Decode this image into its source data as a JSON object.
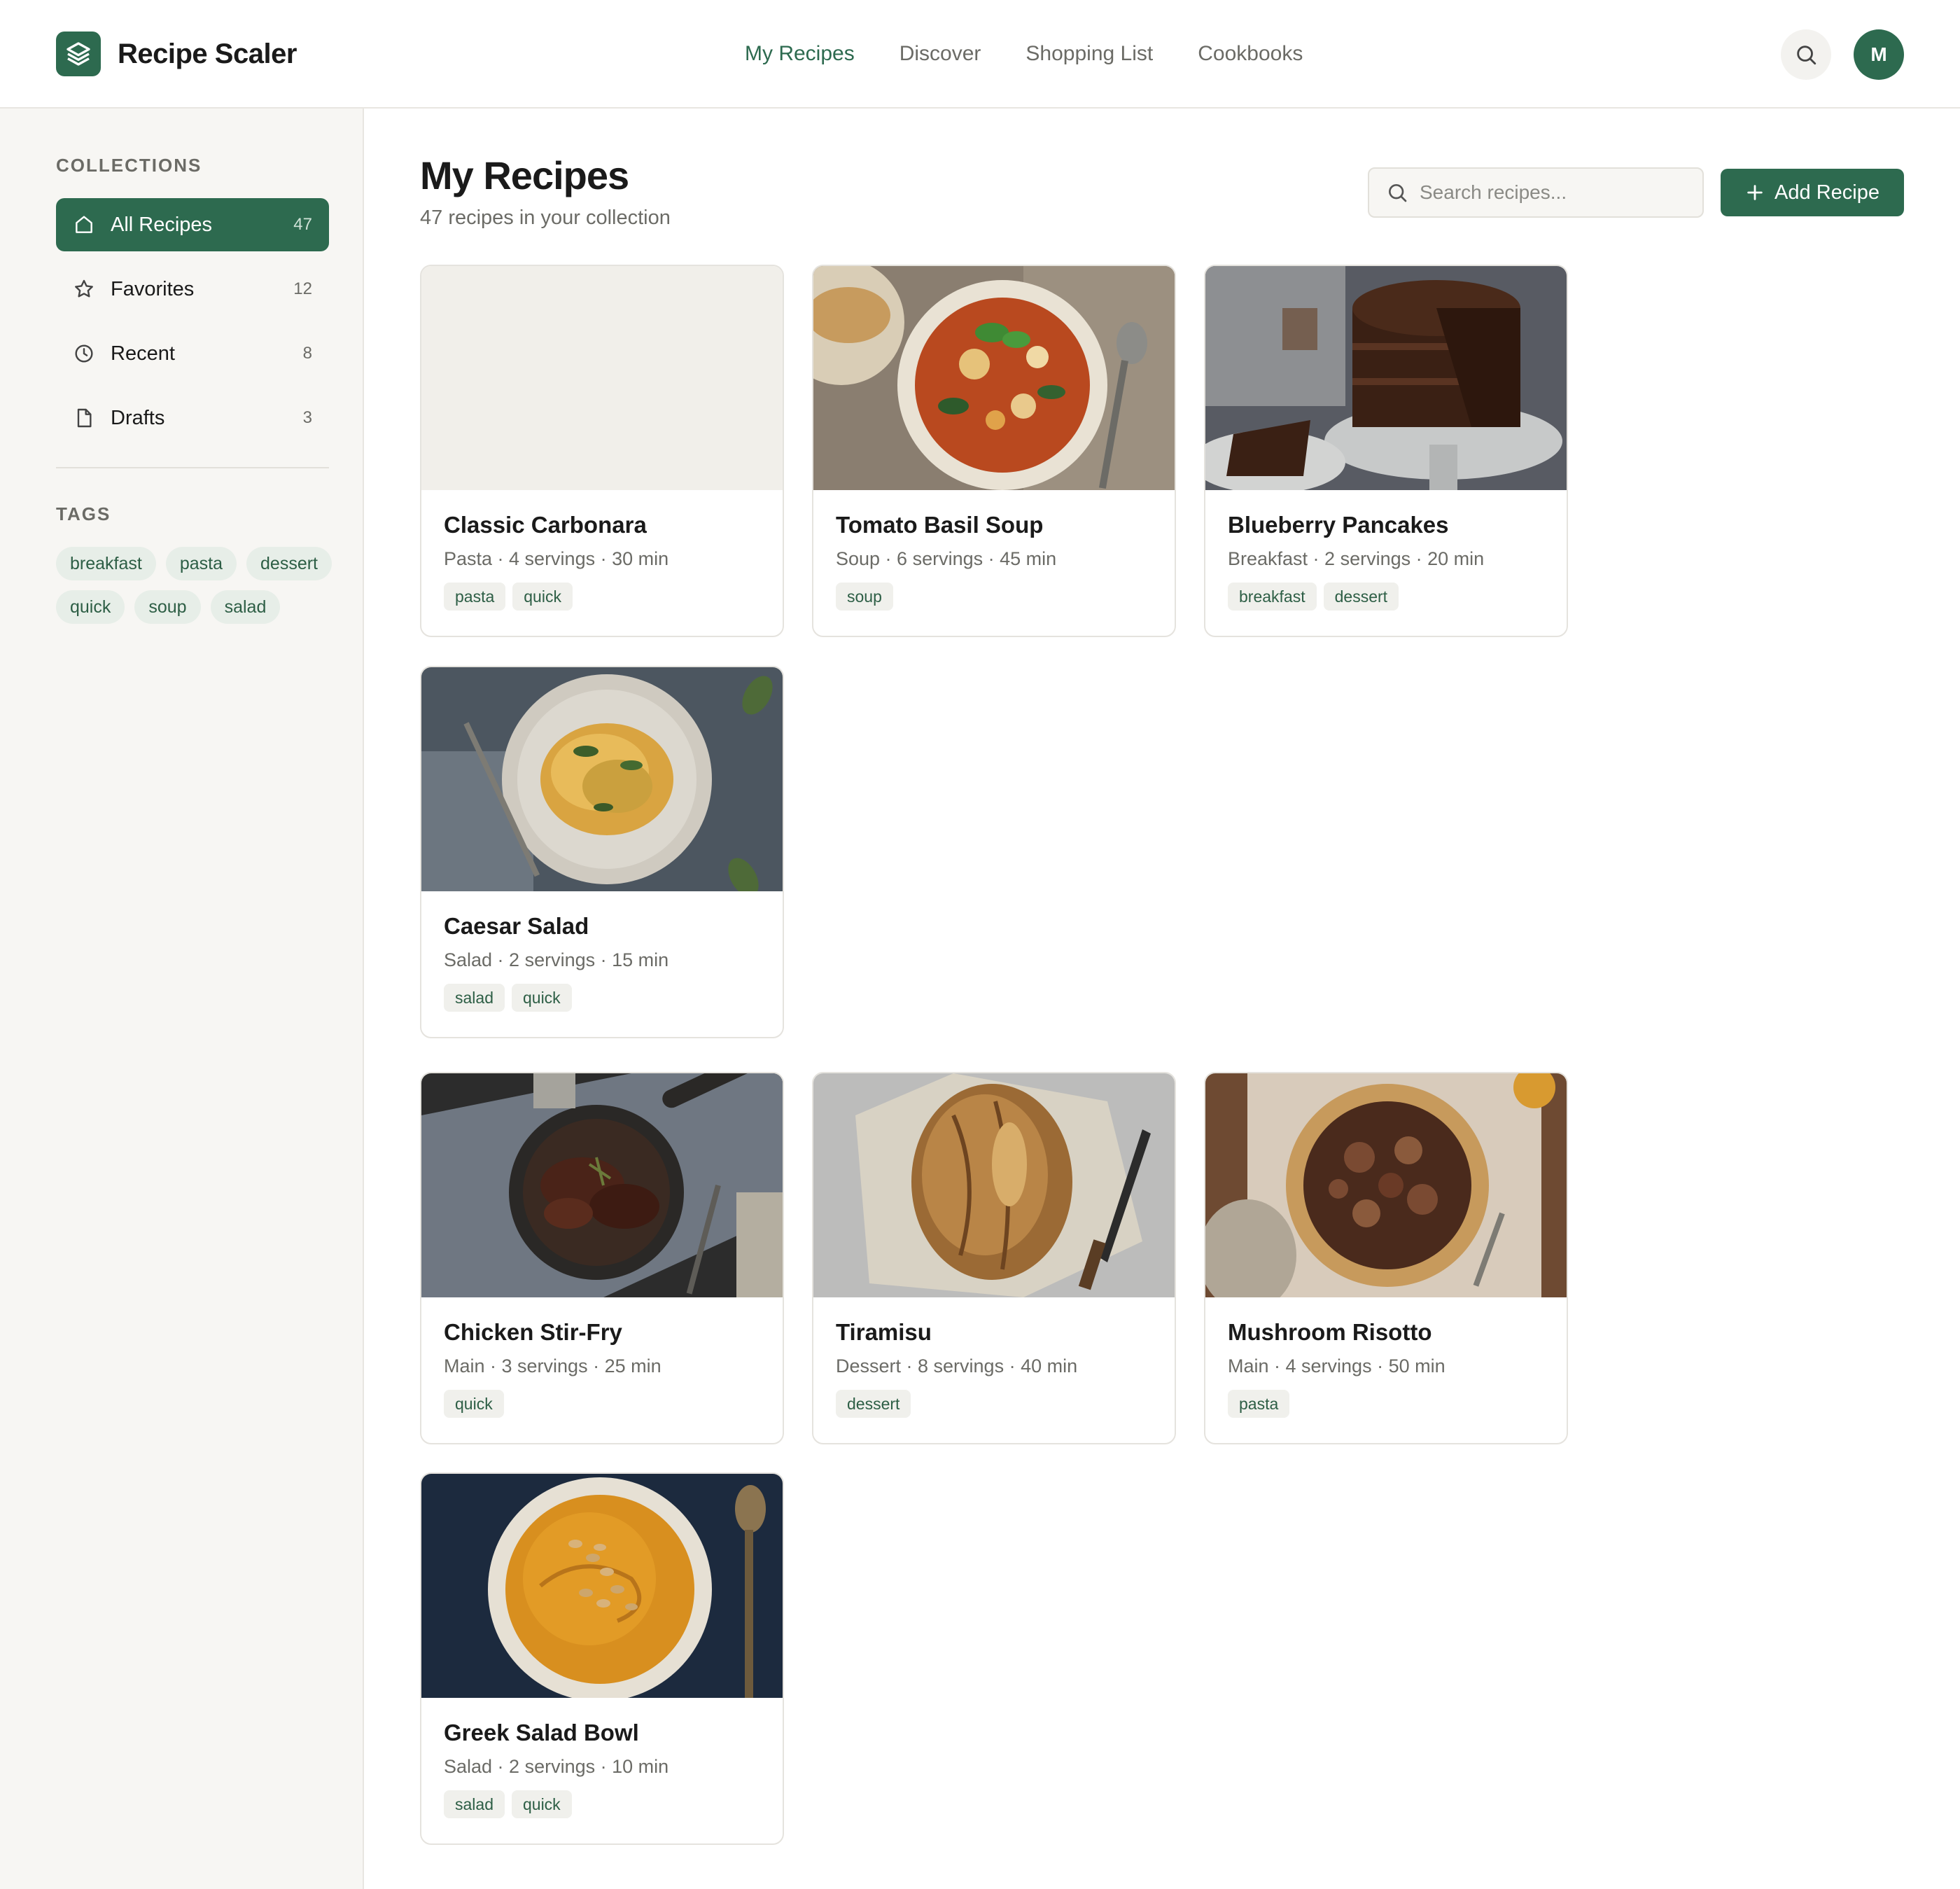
{
  "app": {
    "title": "Recipe Scaler",
    "avatar_initial": "M"
  },
  "nav": [
    {
      "label": "My Recipes",
      "active": true
    },
    {
      "label": "Discover"
    },
    {
      "label": "Shopping List"
    },
    {
      "label": "Cookbooks"
    }
  ],
  "sidebar": {
    "collections_label": "COLLECTIONS",
    "items": [
      {
        "label": "All Recipes",
        "count": "47",
        "icon": "home-icon"
      },
      {
        "label": "Favorites",
        "count": "12",
        "icon": "star-icon"
      },
      {
        "label": "Recent",
        "count": "8",
        "icon": "clock-icon"
      },
      {
        "label": "Drafts",
        "count": "3",
        "icon": "file-icon"
      }
    ],
    "tags_label": "TAGS",
    "tags": [
      "breakfast",
      "pasta",
      "dessert",
      "quick",
      "soup",
      "salad"
    ]
  },
  "main": {
    "title": "My Recipes",
    "subtitle": "47 recipes in your collection",
    "search_placeholder": "Search recipes...",
    "add_label": "Add Recipe",
    "recipes": [
      {
        "name": "Classic Carbonara",
        "meta": "Pasta · 4 servings · 30 min",
        "tags": [
          "pasta",
          "quick"
        ],
        "image": "placeholder"
      },
      {
        "name": "Tomato Basil Soup",
        "meta": "Soup · 6 servings · 45 min",
        "tags": [
          "soup"
        ],
        "image": "soup-bowl"
      },
      {
        "name": "Blueberry Pancakes",
        "meta": "Breakfast · 2 servings · 20 min",
        "tags": [
          "breakfast",
          "dessert"
        ],
        "image": "chocolate-cake"
      },
      {
        "name": "Caesar Salad",
        "meta": "Salad · 2 servings · 15 min",
        "tags": [
          "salad",
          "quick"
        ],
        "image": "pasta-plate"
      },
      {
        "name": "Chicken Stir-Fry",
        "meta": "Main · 3 servings · 25 min",
        "tags": [
          "quick"
        ],
        "image": "skillet"
      },
      {
        "name": "Tiramisu",
        "meta": "Dessert · 8 servings · 40 min",
        "tags": [
          "dessert"
        ],
        "image": "bread-loaf"
      },
      {
        "name": "Mushroom Risotto",
        "meta": "Main · 4 servings · 50 min",
        "tags": [
          "pasta"
        ],
        "image": "galette"
      },
      {
        "name": "Greek Salad Bowl",
        "meta": "Salad · 2 servings · 10 min",
        "tags": [
          "salad",
          "quick"
        ],
        "image": "squash-soup"
      }
    ]
  },
  "colors": {
    "accent": "#2d6a4f",
    "sidebar_bg": "#f7f6f3",
    "tag_bg": "#e7eee8"
  }
}
